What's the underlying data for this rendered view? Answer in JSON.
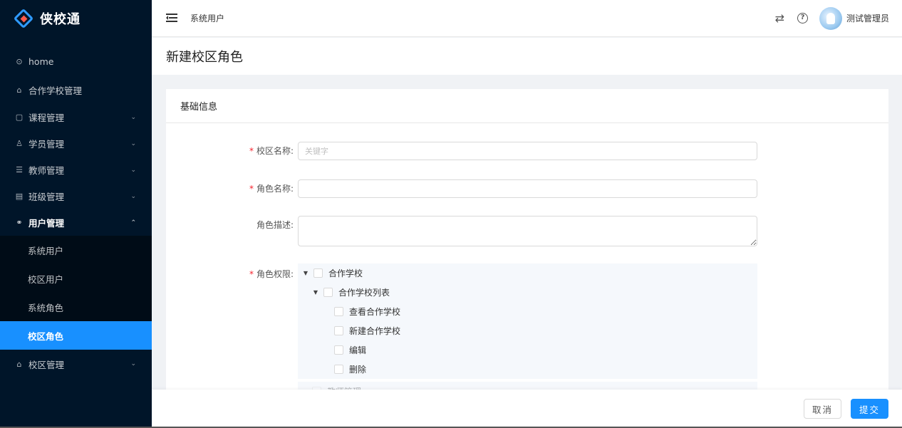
{
  "app": {
    "name": "侠校通"
  },
  "sidebar": {
    "items": [
      {
        "icon": "⊙",
        "label": "home",
        "arrow": ""
      },
      {
        "icon": "⌂",
        "label": "合作学校管理",
        "arrow": ""
      },
      {
        "icon": "▢",
        "label": "课程管理",
        "arrow": "⌄"
      },
      {
        "icon": "♙",
        "label": "学员管理",
        "arrow": "⌄"
      },
      {
        "icon": "☰",
        "label": "教师管理",
        "arrow": "⌄"
      },
      {
        "icon": "▤",
        "label": "班级管理",
        "arrow": "⌄"
      },
      {
        "icon": "⚭",
        "label": "用户管理",
        "arrow": "⌃"
      },
      {
        "icon": "⌂",
        "label": "校区管理",
        "arrow": "⌄"
      }
    ],
    "submenu": [
      "系统用户",
      "校区用户",
      "系统角色",
      "校区角色"
    ]
  },
  "header": {
    "breadcrumb": "系统用户",
    "swap_icon": "⇄",
    "help_icon": "?",
    "username": "测试管理员"
  },
  "page": {
    "title": "新建校区角色"
  },
  "card": {
    "title": "基础信息",
    "fields": {
      "campus_name": {
        "label": "校区名称:",
        "placeholder": "关键字",
        "value": ""
      },
      "role_name": {
        "label": "角色名称:",
        "value": ""
      },
      "role_desc": {
        "label": "角色描述:",
        "value": ""
      },
      "permissions": {
        "label": "角色权限:"
      }
    },
    "tree": {
      "root": "合作学校",
      "child": "合作学校列表",
      "leaves": [
        "查看合作学校",
        "新建合作学校",
        "编辑",
        "删除"
      ],
      "next_root": "教师管理"
    }
  },
  "footer": {
    "cancel": "取消",
    "submit": "提交"
  },
  "colors": {
    "sidebar": "#001529",
    "accent": "#1890ff",
    "required": "#f5222d"
  }
}
